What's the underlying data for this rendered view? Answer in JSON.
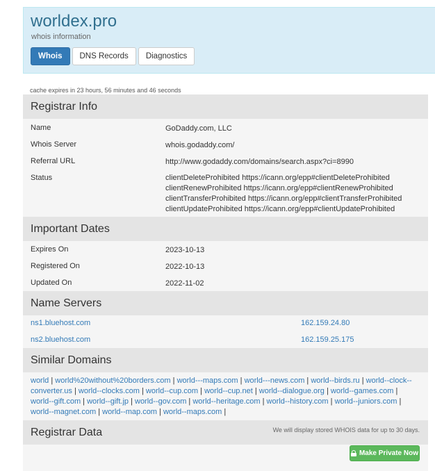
{
  "header": {
    "title": "worldex.pro",
    "subtitle": "whois information",
    "tabs": [
      {
        "label": "Whois",
        "active": true
      },
      {
        "label": "DNS Records",
        "active": false
      },
      {
        "label": "Diagnostics",
        "active": false
      }
    ]
  },
  "cache_notice": "cache expires in 23 hours, 56 minutes and 46 seconds",
  "registrar_info": {
    "heading": "Registrar Info",
    "name_label": "Name",
    "name_value": "GoDaddy.com, LLC",
    "whois_server_label": "Whois Server",
    "whois_server_value": "whois.godaddy.com/",
    "referral_url_label": "Referral URL",
    "referral_url_value": "http://www.godaddy.com/domains/search.aspx?ci=8990",
    "status_label": "Status",
    "status_lines": [
      "clientDeleteProhibited https://icann.org/epp#clientDeleteProhibited",
      "clientRenewProhibited https://icann.org/epp#clientRenewProhibited",
      "clientTransferProhibited https://icann.org/epp#clientTransferProhibited",
      "clientUpdateProhibited https://icann.org/epp#clientUpdateProhibited"
    ]
  },
  "important_dates": {
    "heading": "Important Dates",
    "expires_label": "Expires On",
    "expires_value": "2023-10-13",
    "registered_label": "Registered On",
    "registered_value": "2022-10-13",
    "updated_label": "Updated On",
    "updated_value": "2022-11-02"
  },
  "name_servers": {
    "heading": "Name Servers",
    "servers": [
      {
        "host": "ns1.bluehost.com",
        "ip": "162.159.24.80"
      },
      {
        "host": "ns2.bluehost.com",
        "ip": "162.159.25.175"
      }
    ]
  },
  "similar_domains": {
    "heading": "Similar Domains",
    "items": [
      "world",
      "world%20without%20borders.com",
      "world---maps.com",
      "world---news.com",
      "world--birds.ru",
      "world--clock--converter.us",
      "world--clocks.com",
      "world--cup.com",
      "world--cup.net",
      "world--dialogue.org",
      "world--games.com",
      "world--gift.com",
      "world--gift.jp",
      "world--gov.com",
      "world--heritage.com",
      "world--history.com",
      "world--juniors.com",
      "world--magnet.com",
      "world--map.com",
      "world--maps.com"
    ]
  },
  "registrar_data": {
    "heading": "Registrar Data",
    "note": "We will display stored WHOIS data for up to 30 days.",
    "button_label": "Make Private Now"
  },
  "colors": {
    "header_bg": "#d9edf7",
    "primary": "#337ab7",
    "success": "#5cb85c"
  }
}
